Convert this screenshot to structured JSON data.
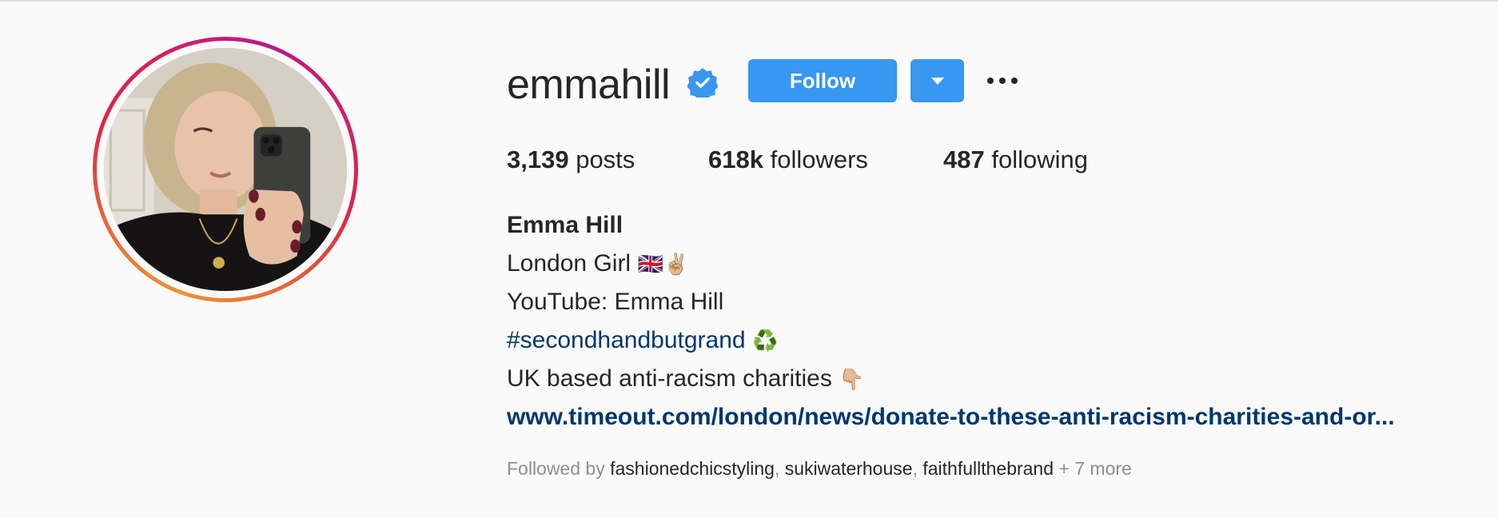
{
  "profile": {
    "username": "emmahill",
    "verified": true,
    "follow_label": "Follow",
    "stats": {
      "posts_count": "3,139",
      "posts_label": "posts",
      "followers_count": "618k",
      "followers_label": "followers",
      "following_count": "487",
      "following_label": "following"
    },
    "bio": {
      "name": "Emma Hill",
      "line1": "London Girl",
      "line1_emoji": "🇬🇧✌🏼",
      "line2": "YouTube: Emma Hill",
      "hashtag": "#secondhandbutgrand",
      "hashtag_emoji": "♻️",
      "line4": "UK based anti-racism charities",
      "line4_emoji": "👇🏼",
      "link": "www.timeout.com/london/news/donate-to-these-anti-racism-charities-and-or..."
    },
    "followed_by": {
      "prefix": "Followed by",
      "accounts": [
        "fashionedchicstyling",
        "sukiwaterhouse",
        "faithfullthebrand"
      ],
      "more": "+ 7 more"
    }
  },
  "colors": {
    "accent": "#3897f0",
    "link": "#00376b",
    "muted": "#8e8e8e",
    "text": "#262626",
    "background": "#fafafa"
  },
  "icons": [
    "verified-badge-icon",
    "dropdown-caret-icon",
    "more-options-icon"
  ]
}
